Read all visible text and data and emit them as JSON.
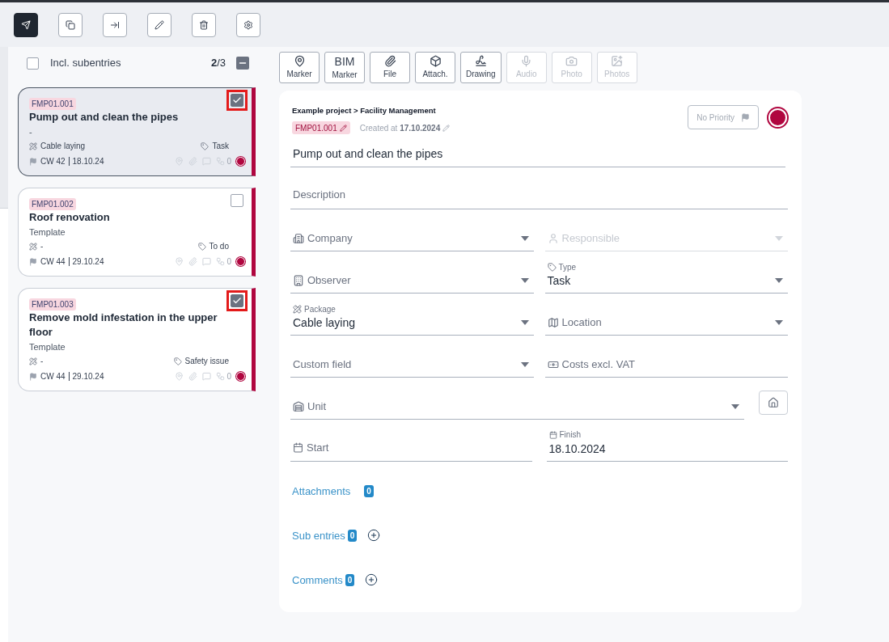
{
  "toolbar": [
    {
      "selected": true
    },
    {
      "selected": false
    },
    {
      "selected": false
    },
    {
      "selected": false
    },
    {
      "selected": false
    },
    {
      "selected": false
    }
  ],
  "list_header": {
    "label": "Incl. subentries",
    "checked": false,
    "count": "**2**/3",
    "select_all_partial": true
  },
  "cards": [
    {
      "id": "FMP01.001",
      "title": "Pump out and clean the pipes",
      "subtitle": "-",
      "package": "Cable laying",
      "type": "Task",
      "week": "CW 42",
      "date": "18.10.24",
      "count": "0",
      "checked": true,
      "selected": true,
      "color": "#b0063f"
    },
    {
      "id": "FMP01.002",
      "title": "Roof renovation",
      "subtitle": "Template",
      "package": "-",
      "type": "To do",
      "week": "CW 44",
      "date": "29.10.24",
      "count": "0",
      "checked": false,
      "selected": false,
      "color": "#b0063f"
    },
    {
      "id": "FMP01.003",
      "title": "Remove mold infestation in the upper floor",
      "subtitle": "Template",
      "package": "-",
      "type": "Safety issue",
      "week": "CW 44",
      "date": "29.10.24",
      "count": "0",
      "checked": true,
      "selected": false,
      "color": "#b0063f"
    }
  ],
  "attach_buttons": [
    {
      "kind": "icon",
      "label": "Marker",
      "disabled": false
    },
    {
      "kind": "text",
      "icon_text": "BIM",
      "label": "Marker",
      "disabled": false
    },
    {
      "kind": "icon",
      "label": "File",
      "disabled": false
    },
    {
      "kind": "icon",
      "label": "Attach.",
      "disabled": false
    },
    {
      "kind": "icon",
      "label": "Drawing",
      "disabled": false
    },
    {
      "kind": "icon",
      "label": "Audio",
      "disabled": true
    },
    {
      "kind": "icon",
      "label": "Photo",
      "disabled": true
    },
    {
      "kind": "icon",
      "label": "Photos",
      "disabled": true
    }
  ],
  "detail": {
    "breadcrumb": "Example project > Facility Management",
    "id": "FMP01.001",
    "created": "Created at **17.10.2024**",
    "priority": "No Priority",
    "status": {
      "color": "#b0063f"
    },
    "title": "Pump out and clean the pipes",
    "description_placeholder": "Description",
    "fields": [
      {
        "kind": "select",
        "label": "Company",
        "disabled": false
      },
      {
        "kind": "select",
        "label": "Responsible",
        "disabled": true
      },
      {
        "kind": "select",
        "label": "Observer",
        "disabled": false
      },
      {
        "kind": "select",
        "label": "Type",
        "value": "Task",
        "disabled": false
      },
      {
        "kind": "select",
        "label": "Package",
        "value": "Cable laying",
        "disabled": false
      },
      {
        "kind": "select",
        "label": "Location",
        "disabled": false
      },
      {
        "kind": "select",
        "label": "Custom field",
        "disabled": false
      },
      {
        "kind": "input",
        "label": "Costs excl. VAT",
        "disabled": false
      }
    ],
    "unit": {
      "label": "Unit"
    },
    "dates": [
      {
        "label": "Start"
      },
      {
        "label": "Finish",
        "value": "18.10.2024"
      }
    ],
    "sections": [
      {
        "label": "Attachments",
        "count": "0",
        "addable": false
      },
      {
        "label": "Sub entries",
        "count": "0",
        "addable": true
      },
      {
        "label": "Comments",
        "count": "0",
        "addable": true
      }
    ]
  }
}
